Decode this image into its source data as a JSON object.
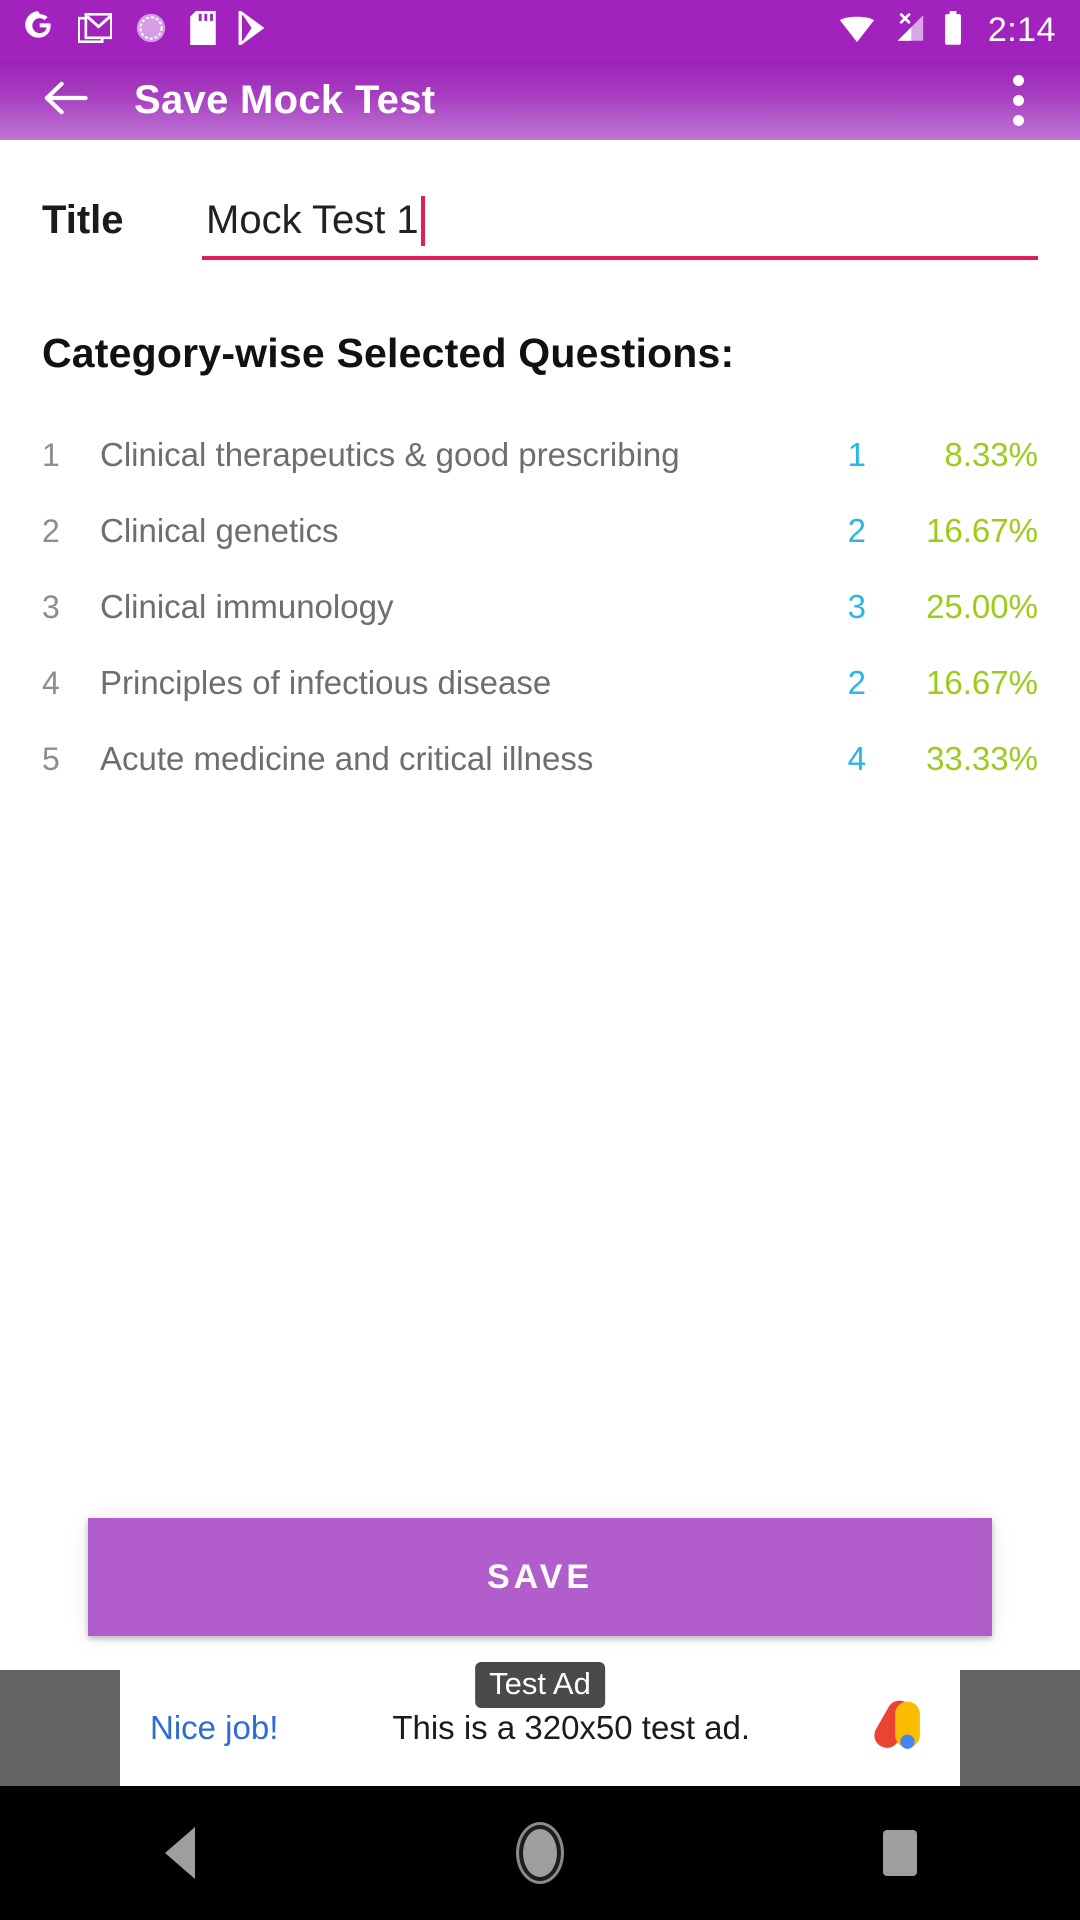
{
  "status_bar": {
    "icons": [
      "google-icon",
      "gmail-icon",
      "sync-circle-icon",
      "sd-card-icon",
      "play-store-icon"
    ],
    "right_icons": [
      "wifi-icon",
      "cellular-no-sim-icon",
      "battery-full-icon"
    ],
    "time": "2:14"
  },
  "app_bar": {
    "back_icon": "arrow-back-icon",
    "title": "Save Mock Test",
    "overflow_icon": "more-vert-icon",
    "bg_top": "#9B21B6",
    "bg_bottom": "#BE76D4"
  },
  "form": {
    "title_label": "Title",
    "title_value": "Mock Test 1",
    "title_placeholder": "Title",
    "underline_color": "#E01E5A"
  },
  "section": {
    "heading": "Category-wise Selected Questions:"
  },
  "categories": [
    {
      "index": "1",
      "name": "Clinical therapeutics & good prescribing",
      "count": "1",
      "percent": "8.33%"
    },
    {
      "index": "2",
      "name": "Clinical genetics",
      "count": "2",
      "percent": "16.67%"
    },
    {
      "index": "3",
      "name": "Clinical immunology",
      "count": "3",
      "percent": "25.00%"
    },
    {
      "index": "4",
      "name": "Principles of infectious disease",
      "count": "2",
      "percent": "16.67%"
    },
    {
      "index": "5",
      "name": "Acute medicine and critical illness",
      "count": "4",
      "percent": "33.33%"
    }
  ],
  "colors": {
    "count": "#29B6E8",
    "percent": "#9CCC18",
    "save_button": "#B15DCB"
  },
  "save": {
    "label": "SAVE"
  },
  "ad": {
    "badge": "Test Ad",
    "cta": "Nice job!",
    "text": "This is a 320x50 test ad.",
    "logo_icon": "admob-logo-icon"
  },
  "nav_bar": {
    "back_icon": "nav-back-icon",
    "home_icon": "nav-home-icon",
    "recents_icon": "nav-recents-icon"
  }
}
